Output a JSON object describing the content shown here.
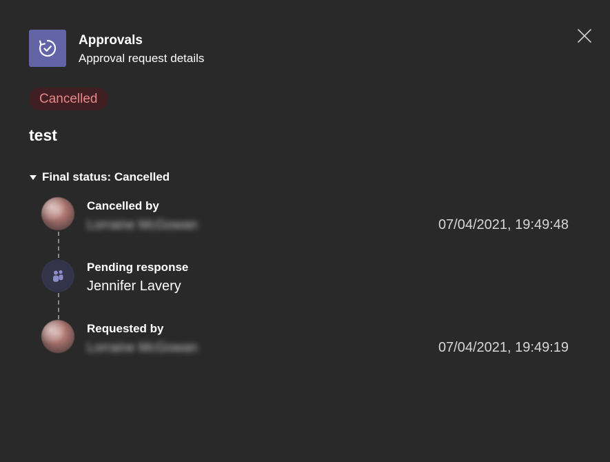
{
  "header": {
    "app_name": "Approvals",
    "subtitle": "Approval request details",
    "app_icon": "approvals-refresh-check-icon",
    "close_icon": "close-icon"
  },
  "status": {
    "label": "Cancelled",
    "color": "#e8868b",
    "background": "#3f1f22"
  },
  "request": {
    "title": "test"
  },
  "section": {
    "label": "Final status: Cancelled",
    "expanded": true
  },
  "timeline": [
    {
      "label": "Cancelled by",
      "person": "Lorraine McGowan",
      "timestamp": "07/04/2021, 19:49:48",
      "icon": "avatar-photo"
    },
    {
      "label": "Pending response",
      "person": "Jennifer Lavery",
      "timestamp": "",
      "icon": "people-icon"
    },
    {
      "label": "Requested by",
      "person": "Lorraine McGowan",
      "timestamp": "07/04/2021, 19:49:19",
      "icon": "avatar-photo"
    }
  ],
  "colors": {
    "background": "#292929",
    "accent": "#6264a7",
    "timeline_line": "#8a8a8a"
  }
}
